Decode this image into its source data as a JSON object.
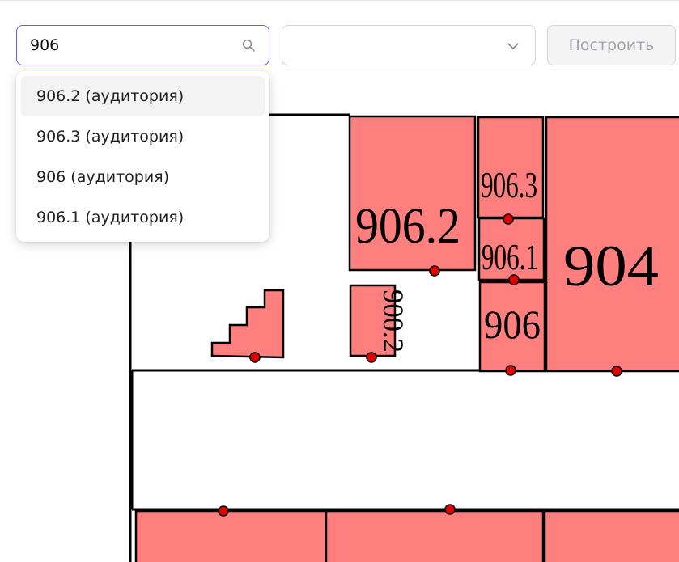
{
  "search": {
    "value": "906",
    "placeholder": "",
    "icon": "search-icon"
  },
  "select": {
    "value": "",
    "icon": "chevron-down-icon"
  },
  "build_button": {
    "label": "Построить"
  },
  "dropdown": {
    "options": [
      {
        "label": "906.2 (аудитория)",
        "active": true
      },
      {
        "label": "906.3 (аудитория)",
        "active": false
      },
      {
        "label": "906 (аудитория)",
        "active": false
      },
      {
        "label": "906.1 (аудитория)",
        "active": false
      }
    ]
  },
  "map": {
    "rooms": {
      "r906_2": "906.2",
      "r906_3": "906.3",
      "r906_1": "906.1",
      "r906": "906",
      "r904": "904",
      "r900_2": "900.2"
    }
  },
  "colors": {
    "accent": "#6b5cf0",
    "room_fill": "#ff7f7f",
    "entrance_dot": "#e00000",
    "button_bg": "#f4f4f5",
    "button_text": "#a1a1aa"
  }
}
